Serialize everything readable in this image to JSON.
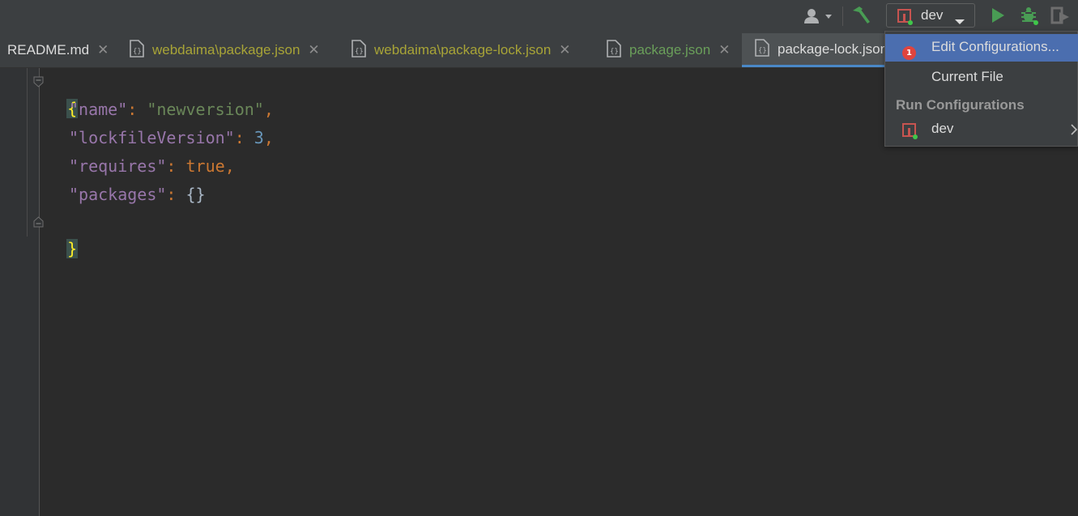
{
  "toolbar": {
    "run_config_label": "dev",
    "user_icon": "user-icon",
    "build_icon": "hammer-icon",
    "run_icon": "run-icon",
    "debug_icon": "debug-icon",
    "coverage_icon": "coverage-icon"
  },
  "tabs": [
    {
      "label": "README.md",
      "color": "#dcdcdc"
    },
    {
      "label": "webdaima\\package.json",
      "color": "#a8a437"
    },
    {
      "label": "webdaima\\package-lock.json",
      "color": "#a8a437"
    },
    {
      "label": "package.json",
      "color": "#6a9f5a"
    },
    {
      "label": "package-lock.json",
      "color": "#dcdcdc"
    }
  ],
  "tab_close_glyph": "✕",
  "editor": {
    "lines": [
      {
        "open": "{"
      },
      {
        "key": "\"name\"",
        "colon": ": ",
        "value": "\"newversion\"",
        "comma": ","
      },
      {
        "key": "\"lockfileVersion\"",
        "colon": ": ",
        "value": "3",
        "comma": ","
      },
      {
        "key": "\"requires\"",
        "colon": ": ",
        "value": "true",
        "comma": ","
      },
      {
        "key": "\"packages\"",
        "colon": ": ",
        "value": "{}"
      },
      {
        "close": "}"
      }
    ]
  },
  "popup": {
    "items": [
      {
        "label": "Edit Configurations...",
        "badge": "1"
      },
      {
        "label": "Current File"
      }
    ],
    "section_title": "Run Configurations",
    "configurations": [
      {
        "label": "dev"
      }
    ]
  },
  "colors": {
    "accent": "#4b6eaf",
    "run_green": "#499c54",
    "config_red": "#c75450",
    "badge_red": "#e0443e"
  }
}
